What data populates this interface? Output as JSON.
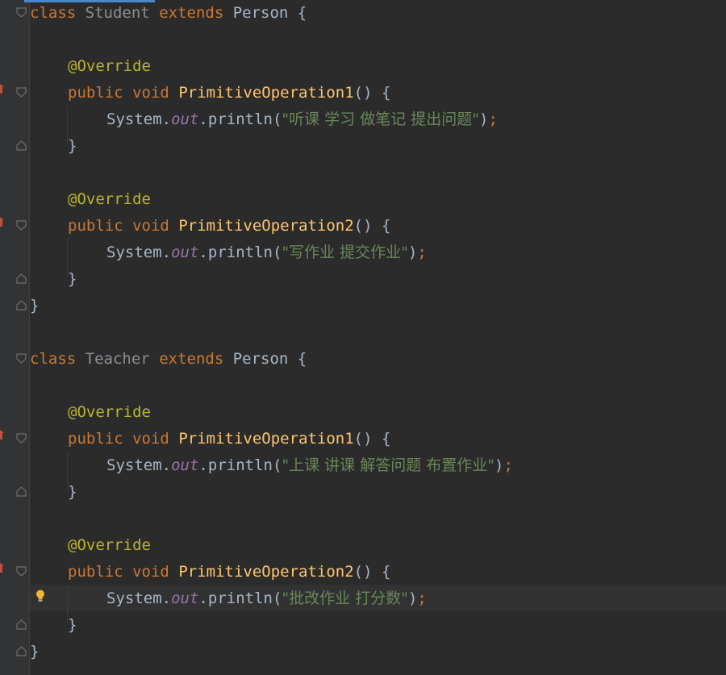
{
  "editor": {
    "language": "Java",
    "theme_colors": {
      "background": "#2b2b2b",
      "gutter": "#313335",
      "keyword": "#cc7832",
      "annotation": "#bbb529",
      "method": "#ffc66d",
      "string": "#6a8759",
      "field": "#9876aa",
      "text": "#a9b7c6"
    },
    "tokens": {
      "class_kw": "class",
      "extends_kw": "extends",
      "public_kw": "public",
      "void_kw": "void",
      "override": "@Override",
      "system": "System",
      "dot": ".",
      "out": "out",
      "println": "println",
      "open_paren": "(",
      "close_paren": ")",
      "parens_brace": "() {",
      "open_brace": " {",
      "close_brace": "}",
      "semicolon": ";",
      "space": " "
    },
    "classes": [
      {
        "name": "Student",
        "parent": "Person",
        "methods": [
          {
            "name": "PrimitiveOperation1",
            "string": "\"听课 学习 做笔记 提出问题\""
          },
          {
            "name": "PrimitiveOperation2",
            "string": "\"写作业 提交作业\""
          }
        ]
      },
      {
        "name": "Teacher",
        "parent": "Person",
        "methods": [
          {
            "name": "PrimitiveOperation1",
            "string": "\"上课 讲课 解答问题 布置作业\""
          },
          {
            "name": "PrimitiveOperation2",
            "string": "\"批改作业 打分数\""
          }
        ]
      }
    ],
    "gutter_icons": [
      "fold-icon",
      "override-method-icon",
      "intention-bulb-icon"
    ]
  }
}
